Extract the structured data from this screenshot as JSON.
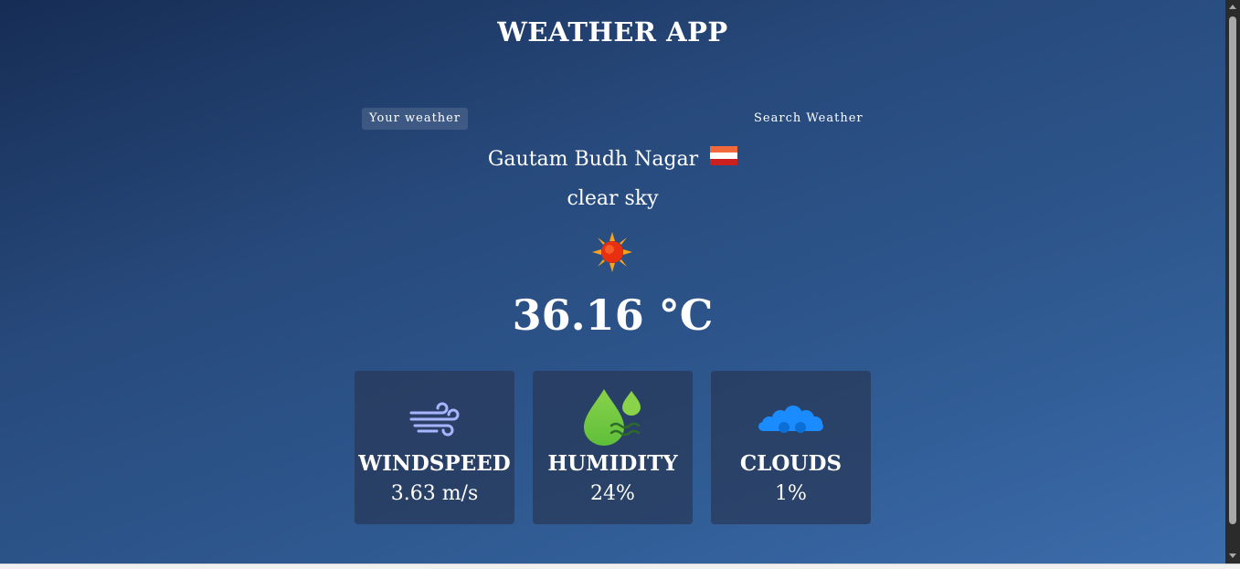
{
  "app": {
    "title": "WEATHER APP"
  },
  "tabs": [
    {
      "label": "Your weather",
      "active": true
    },
    {
      "label": "Search Weather",
      "active": false
    }
  ],
  "weather": {
    "city": "Gautam Budh Nagar",
    "description": "clear sky",
    "icon": "sun-icon",
    "temperature": "36.16 °C"
  },
  "stats": [
    {
      "label": "WINDSPEED",
      "value": "3.63 m/s",
      "icon": "wind-icon"
    },
    {
      "label": "HUMIDITY",
      "value": "24%",
      "icon": "humidity-icon"
    },
    {
      "label": "CLOUDS",
      "value": "1%",
      "icon": "clouds-icon"
    }
  ],
  "colors": {
    "gradient_start": "#162d55",
    "gradient_end": "#3c6cab",
    "card_bg": "#283858",
    "cloud_blue": "#1a8cff",
    "humidity_green": "#8ad24a",
    "wind_lavender": "#a8b4ff"
  }
}
